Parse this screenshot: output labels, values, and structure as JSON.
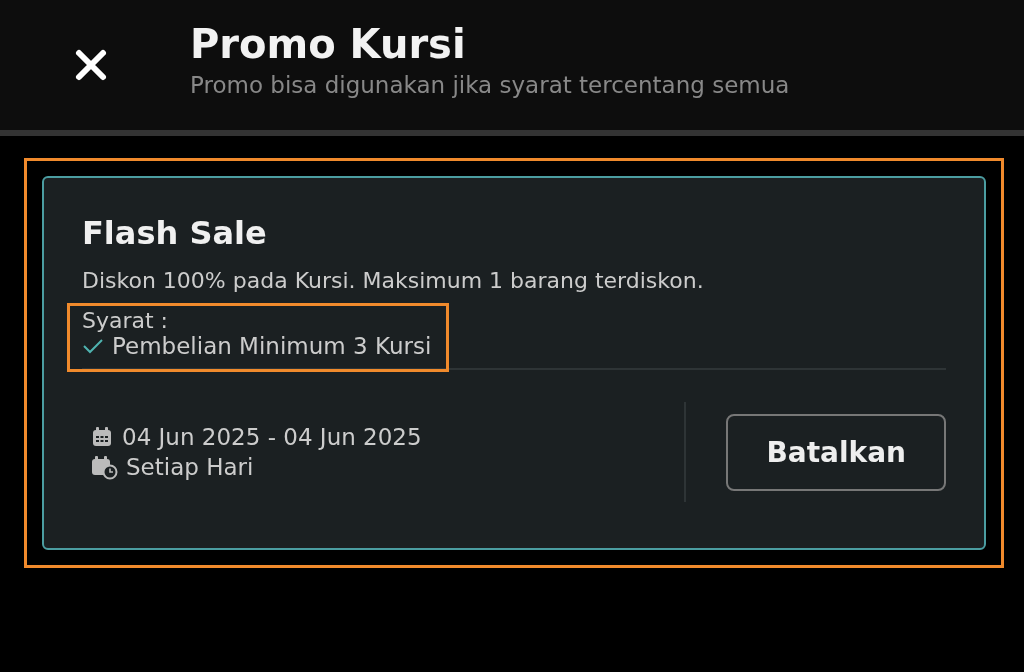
{
  "header": {
    "title": "Promo Kursi",
    "subtitle": "Promo bisa digunakan jika syarat tercentang semua"
  },
  "promo": {
    "highlighted": true,
    "title": "Flash Sale",
    "description": "Diskon 100% pada Kursi. Maksimum 1 barang terdiskon.",
    "conditions": {
      "highlighted": true,
      "label": "Syarat :",
      "items": [
        {
          "text": "Pembelian Minimum 3 Kursi",
          "checked": true
        }
      ]
    },
    "period": "04 Jun 2025 - 04 Jun 2025",
    "schedule": "Setiap Hari",
    "button": "Batalkan"
  }
}
